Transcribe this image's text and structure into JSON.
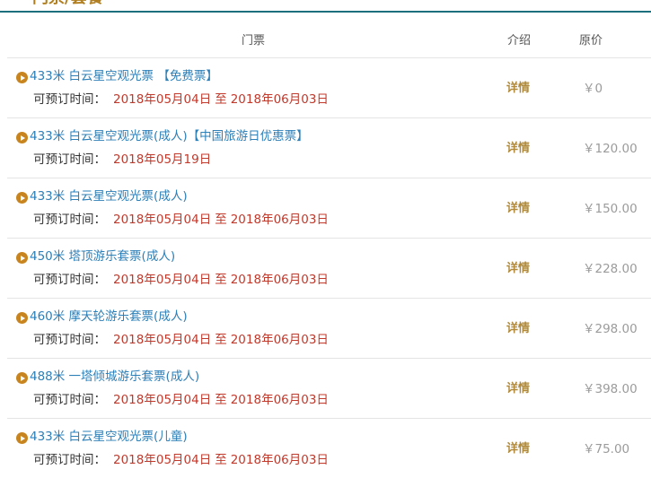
{
  "section": {
    "title": "门票/套餐"
  },
  "columns": {
    "ticket": "门票",
    "intro": "介绍",
    "price": "原价"
  },
  "booking_label": "可预订时间：",
  "to_word": "至",
  "detail_label": "详情",
  "colors": {
    "link": "#2d7fb7",
    "date": "#c0392b",
    "accent": "#c8851f",
    "price": "#9b9b9b",
    "rule": "#1c6f7d"
  },
  "tickets": [
    {
      "name": "433米 白云星空观光票 【免费票】",
      "start": "2018年05月04日",
      "to": "至",
      "end": "2018年06月03日",
      "price": "￥0"
    },
    {
      "name": "433米 白云星空观光票(成人)【中国旅游日优惠票】",
      "start": "2018年05月19日",
      "to": "",
      "end": "",
      "price": "￥120.00"
    },
    {
      "name": "433米 白云星空观光票(成人)",
      "start": "2018年05月04日",
      "to": "至",
      "end": "2018年06月03日",
      "price": "￥150.00"
    },
    {
      "name": "450米 塔顶游乐套票(成人)",
      "start": "2018年05月04日",
      "to": "至",
      "end": "2018年06月03日",
      "price": "￥228.00"
    },
    {
      "name": "460米 摩天轮游乐套票(成人)",
      "start": "2018年05月04日",
      "to": "至",
      "end": "2018年06月03日",
      "price": "￥298.00"
    },
    {
      "name": "488米 一塔倾城游乐套票(成人)",
      "start": "2018年05月04日",
      "to": "至",
      "end": "2018年06月03日",
      "price": "￥398.00"
    },
    {
      "name": "433米 白云星空观光票(儿童)",
      "start": "2018年05月04日",
      "to": "至",
      "end": "2018年06月03日",
      "price": "￥75.00"
    }
  ]
}
